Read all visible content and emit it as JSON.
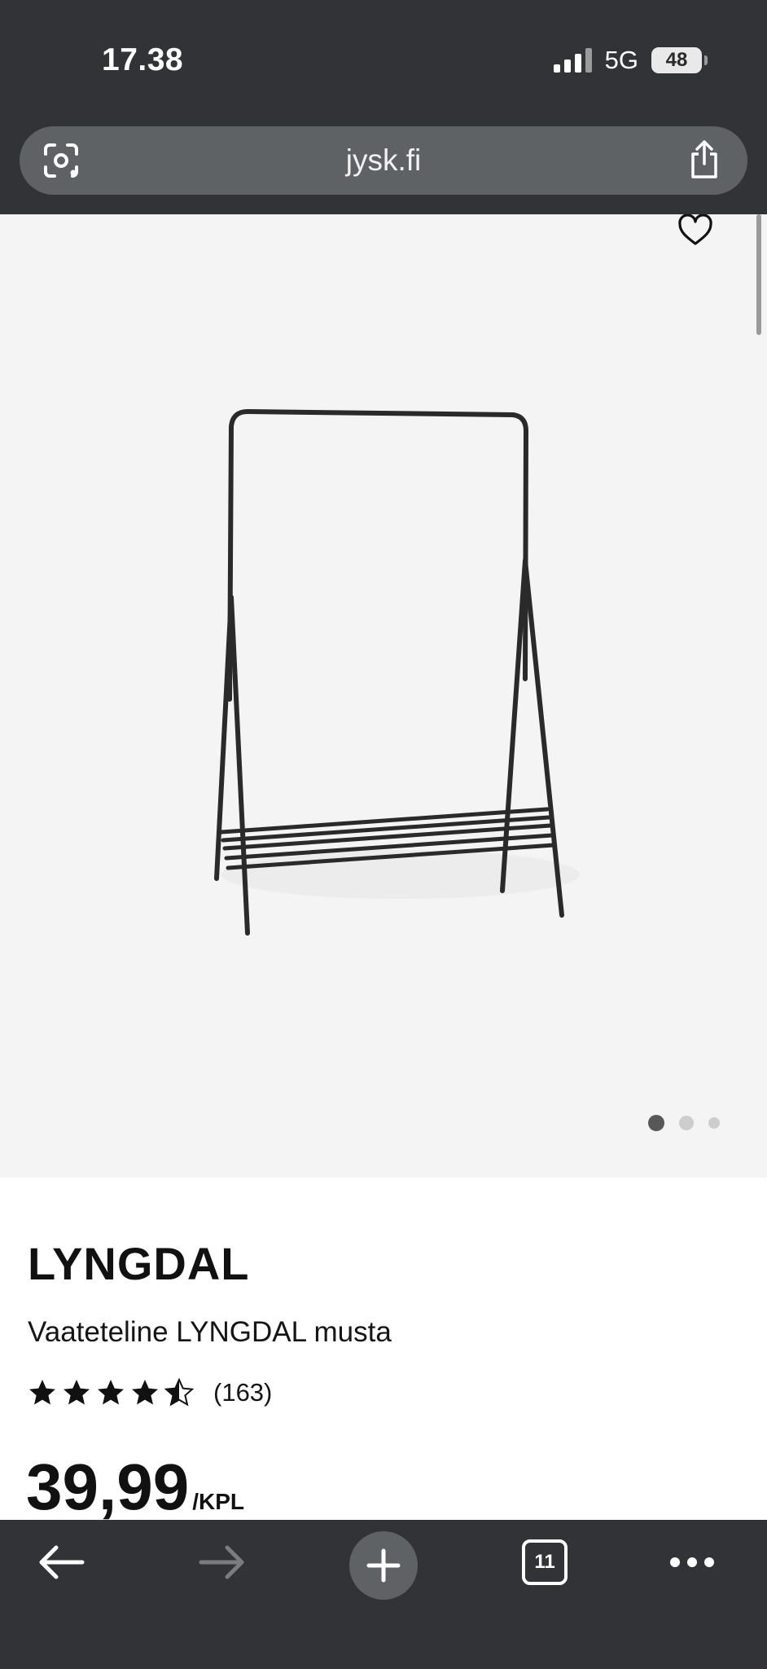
{
  "status_bar": {
    "time": "17.38",
    "network": "5G",
    "battery": "48"
  },
  "browser": {
    "url": "jysk.fi"
  },
  "icons": {
    "lens": "google-lens-icon",
    "share": "share-icon",
    "favorite": "heart-icon",
    "back": "arrow-left-icon",
    "forward": "arrow-right-icon",
    "new_tab": "plus-icon",
    "menu": "more-dots-icon"
  },
  "gallery": {
    "image_count": 3,
    "active_index": 0
  },
  "product": {
    "brand": "LYNGDAL",
    "description": "Vaateteline LYNGDAL musta",
    "rating": 4.5,
    "rating_count": "(163)",
    "price": "39,99",
    "price_unit": "/KPL"
  },
  "toolbar": {
    "tab_count": "11"
  },
  "colors": {
    "chrome": "#313336",
    "urlbar": "#5f6265",
    "gallery_bg": "#f4f4f4"
  }
}
